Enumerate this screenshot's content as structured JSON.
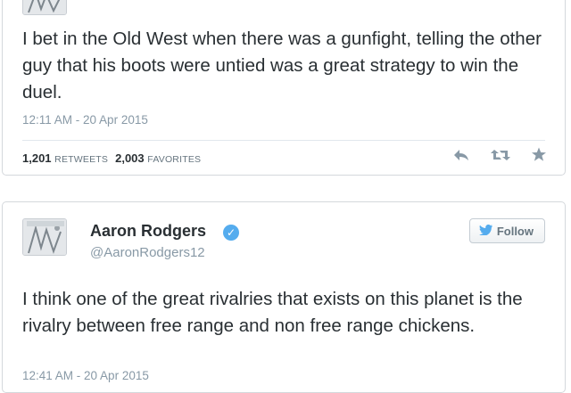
{
  "tweets": [
    {
      "text": "I bet in the Old West when there was a gunfight, telling the other guy that his boots were untied was a great strategy to win the duel.",
      "timestamp": "12:11 AM - 20 Apr 2015",
      "retweets": "1,201",
      "retweets_label": "RETWEETS",
      "favorites": "2,003",
      "favorites_label": "FAVORITES",
      "actions": [
        "reply-icon",
        "retweet-icon",
        "favorite-icon"
      ]
    },
    {
      "author_name": "Aaron Rodgers",
      "author_handle": "@AaronRodgers12",
      "verified": true,
      "follow_label": "Follow",
      "text": "I think one of the great rivalries that exists on this planet is the rivalry between free range and non free range chickens.",
      "timestamp": "12:41 AM - 20 Apr 2015"
    }
  ],
  "colors": {
    "text": "#292f33",
    "muted": "#8899a6",
    "action_icon": "#8899a6",
    "twitter_blue": "#55acee",
    "border": "#d4d8dc"
  }
}
